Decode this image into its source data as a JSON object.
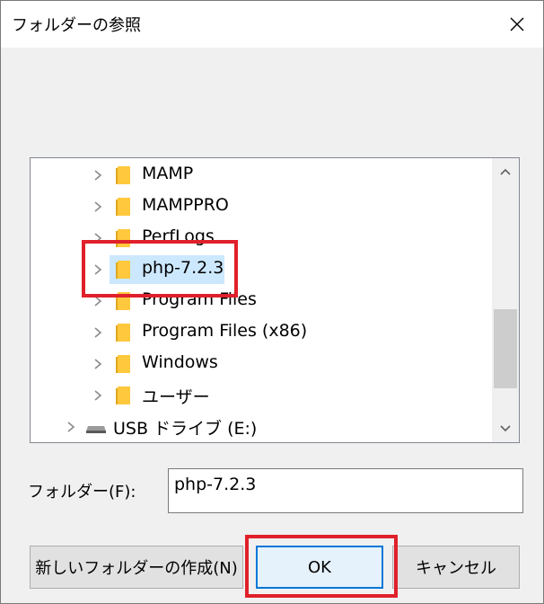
{
  "window": {
    "title": "フォルダーの参照"
  },
  "tree": {
    "items": [
      {
        "label": "MAMP",
        "indent": 1,
        "icon": "folder-icon",
        "selected": false
      },
      {
        "label": "MAMPPRO",
        "indent": 1,
        "icon": "folder-icon",
        "selected": false
      },
      {
        "label": "PerfLogs",
        "indent": 1,
        "icon": "folder-icon",
        "selected": false
      },
      {
        "label": "php-7.2.3",
        "indent": 1,
        "icon": "folder-icon",
        "selected": true
      },
      {
        "label": "Program Files",
        "indent": 1,
        "icon": "folder-icon",
        "selected": false
      },
      {
        "label": "Program Files (x86)",
        "indent": 1,
        "icon": "folder-icon",
        "selected": false
      },
      {
        "label": "Windows",
        "indent": 1,
        "icon": "folder-icon",
        "selected": false
      },
      {
        "label": "ユーザー",
        "indent": 1,
        "icon": "folder-icon",
        "selected": false
      },
      {
        "label": "USB ドライブ (E:)",
        "indent": 0,
        "icon": "usb-drive-icon",
        "selected": false
      }
    ]
  },
  "folder_field": {
    "label": "フォルダー(F):",
    "value": "php-7.2.3"
  },
  "buttons": {
    "new_folder": "新しいフォルダーの作成(N)",
    "ok": "OK",
    "cancel": "キャンセル"
  },
  "colors": {
    "highlight": "#e0202a",
    "selection": "#cce8ff",
    "folder": "#ffc83d",
    "focus": "#0078d7"
  }
}
